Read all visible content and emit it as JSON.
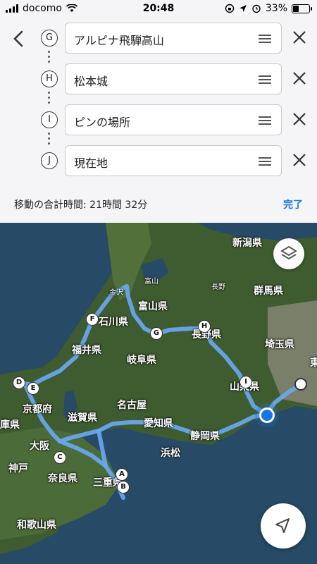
{
  "status": {
    "carrier": "docomo",
    "time": "20:48",
    "battery": "33%"
  },
  "waypoints": [
    {
      "letter": "G",
      "value": "アルピナ飛騨高山"
    },
    {
      "letter": "H",
      "value": "松本城"
    },
    {
      "letter": "I",
      "value": "ピンの場所"
    },
    {
      "letter": "J",
      "value": "現在地"
    }
  ],
  "summary": "移動の合計時間: 21時間 32分",
  "done_label": "完了",
  "map": {
    "labels": {
      "niigata": "新潟県",
      "gunma": "群馬県",
      "nagano_city": "長野",
      "nagano": "長野県",
      "toyama_city": "富山",
      "toyama": "富山県",
      "kanazawa": "金沢",
      "ishikawa": "石川県",
      "fukui": "福井県",
      "gifu": "岐阜県",
      "saitama": "埼玉県",
      "yamanashi": "山梨県",
      "kyoto": "京都府",
      "shiga": "滋賀県",
      "nagoya": "名古屋",
      "aichi": "愛知県",
      "shizuoka": "静岡県",
      "hamamatsu": "浜松",
      "osaka": "大阪",
      "kobe": "神戸",
      "nara": "奈良県",
      "mie": "三重県",
      "wakayama": "和歌山県",
      "hyogo": "庫県",
      "east": "東"
    },
    "markers": [
      "A",
      "B",
      "C",
      "D",
      "E",
      "F",
      "G",
      "H",
      "I"
    ]
  },
  "colors": {
    "accent": "#1a73e8",
    "route": "#6aa8f5"
  }
}
